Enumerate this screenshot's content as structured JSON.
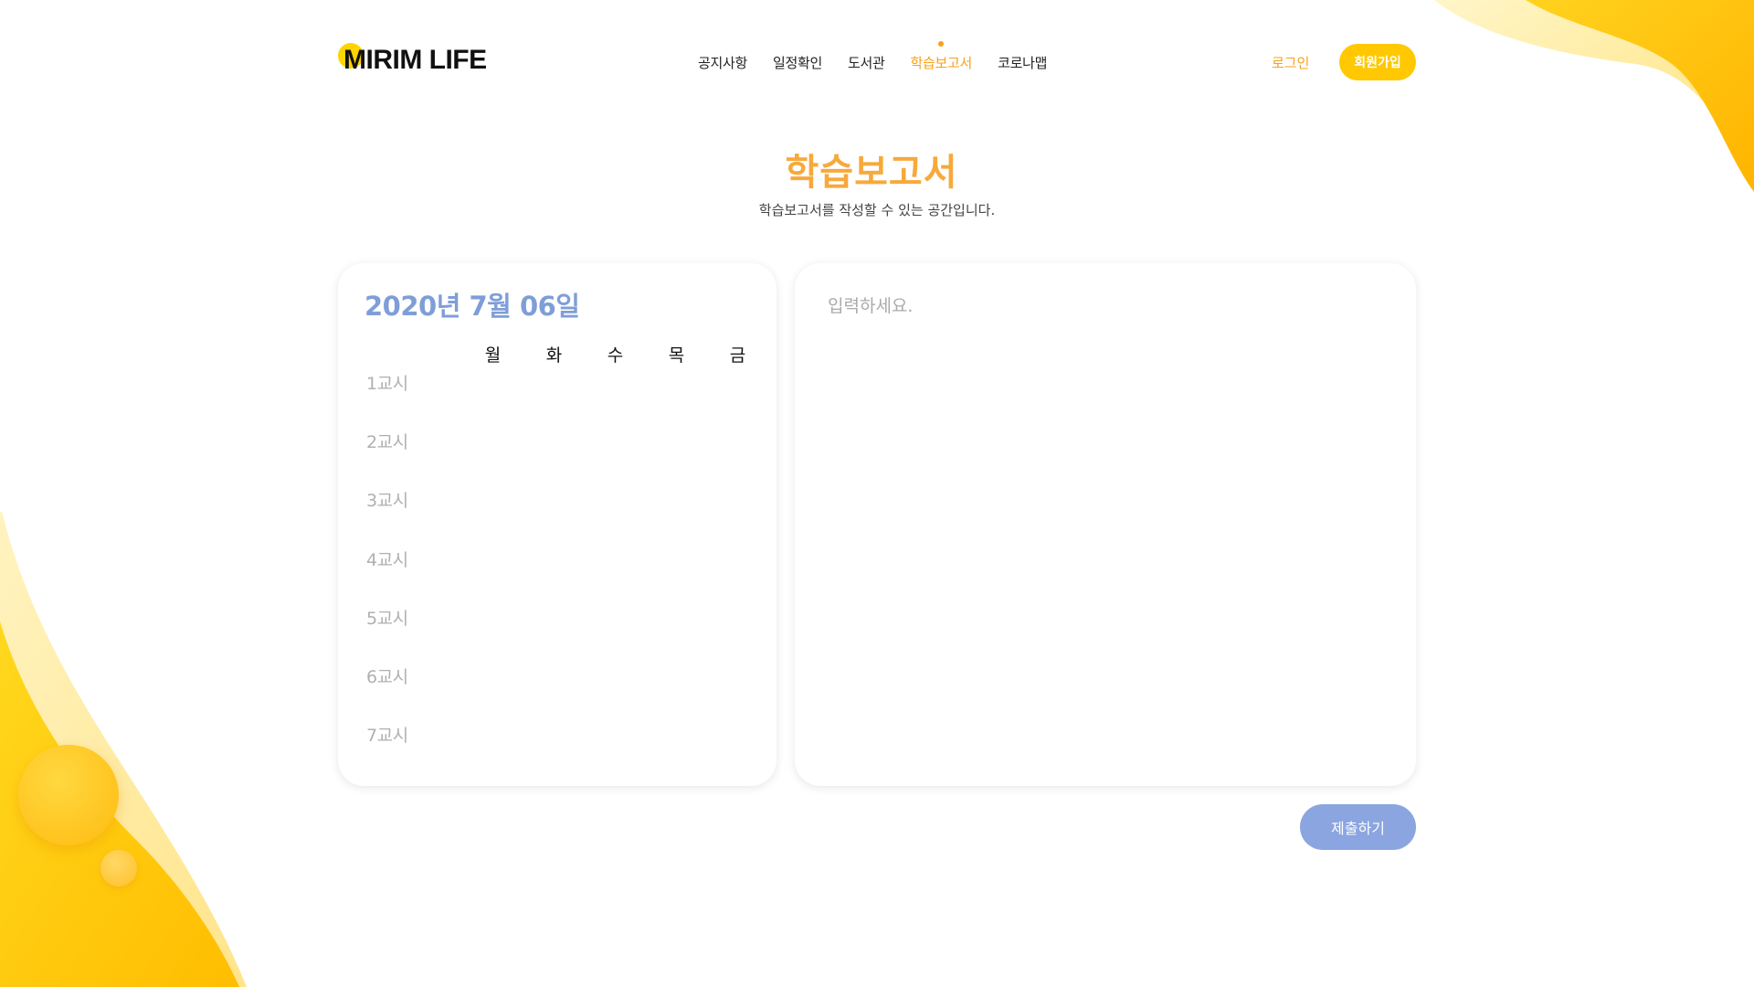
{
  "header": {
    "logo": "MIRIM LIFE",
    "nav": [
      {
        "label": "공지사항",
        "active": false
      },
      {
        "label": "일정확인",
        "active": false
      },
      {
        "label": "도서관",
        "active": false
      },
      {
        "label": "학습보고서",
        "active": true
      },
      {
        "label": "코로나맵",
        "active": false
      }
    ],
    "login": "로그인",
    "signup": "회원가입"
  },
  "page": {
    "title": "학습보고서",
    "subtitle": "학습보고서를 작성할 수 있는 공간입니다."
  },
  "timetable": {
    "date": "2020년 7월 06일",
    "days": [
      "월",
      "화",
      "수",
      "목",
      "금"
    ],
    "periods": [
      "1교시",
      "2교시",
      "3교시",
      "4교시",
      "5교시",
      "6교시",
      "7교시"
    ]
  },
  "report": {
    "placeholder": "입력하세요.",
    "value": ""
  },
  "submit": "제출하기",
  "colors": {
    "accent": "#f7a01b",
    "brand_yellow": "#ffc800",
    "date_blue": "#7f9ed8",
    "submit_blue": "#8ba5e0"
  }
}
